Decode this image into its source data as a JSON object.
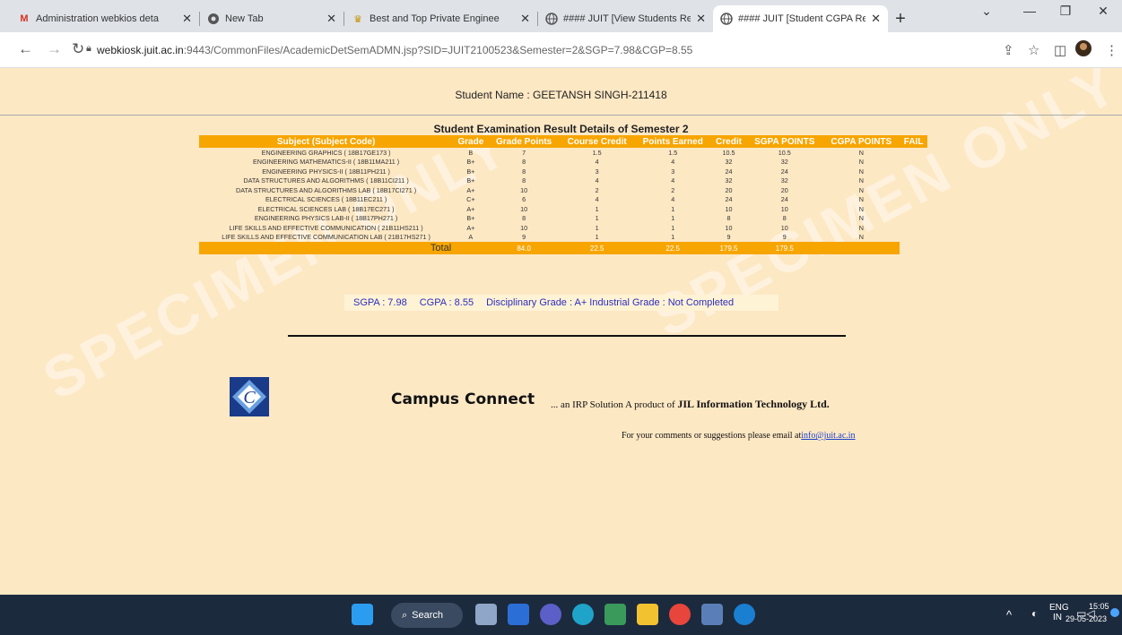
{
  "tabs": [
    {
      "label": "Administration webkios deta",
      "icon": "gmail-icon"
    },
    {
      "label": "New Tab",
      "icon": "chrome-icon"
    },
    {
      "label": "Best and Top Private Enginee",
      "icon": "college-icon"
    },
    {
      "label": "#### JUIT [View Students Re",
      "icon": "globe-icon"
    },
    {
      "label": "#### JUIT [Student CGPA Re",
      "icon": "globe-icon"
    }
  ],
  "address": {
    "host": "webkiosk.juit.ac.in",
    "rest": ":9443/CommonFiles/AcademicDetSemADMN.jsp?SID=JUIT2100523&Semester=2&SGP=7.98&CGP=8.55"
  },
  "page": {
    "student_name": "Student Name : GEETANSH SINGH-211418",
    "section_title": "Student Examination Result Details of Semester 2",
    "watermark": "SPECIMEN ONLY",
    "table": {
      "headers": [
        "Subject (Subject Code)",
        "Grade",
        "Grade Points",
        "Course Credit",
        "Points Earned",
        "Credit",
        "SGPA POINTS",
        "CGPA POINTS",
        "FAIL"
      ],
      "rows": [
        [
          "ENGINEERING GRAPHICS ( 18B17GE173 )",
          "B",
          "7",
          "1.5",
          "1.5",
          "10.5",
          "10.5",
          "N"
        ],
        [
          "ENGINEERING MATHEMATICS-II ( 18B11MA211 )",
          "B+",
          "8",
          "4",
          "4",
          "32",
          "32",
          "N"
        ],
        [
          "ENGINEERING PHYSICS-II ( 18B11PH211 )",
          "B+",
          "8",
          "3",
          "3",
          "24",
          "24",
          "N"
        ],
        [
          "DATA STRUCTURES AND ALGORITHMS ( 18B11CI211 )",
          "B+",
          "8",
          "4",
          "4",
          "32",
          "32",
          "N"
        ],
        [
          "DATA STRUCTURES AND ALGORITHMS LAB ( 18B17CI271 )",
          "A+",
          "10",
          "2",
          "2",
          "20",
          "20",
          "N"
        ],
        [
          "ELECTRICAL SCIENCES ( 18B11EC211 )",
          "C+",
          "6",
          "4",
          "4",
          "24",
          "24",
          "N"
        ],
        [
          "ELECTRICAL SCIENCES LAB ( 18B17EC271 )",
          "A+",
          "10",
          "1",
          "1",
          "10",
          "10",
          "N"
        ],
        [
          "ENGINEERING PHYSICS LAB-II ( 18B17PH271 )",
          "B+",
          "8",
          "1",
          "1",
          "8",
          "8",
          "N"
        ],
        [
          "LIFE SKILLS AND EFFECTIVE COMMUNICATION ( 21B11HS211 )",
          "A+",
          "10",
          "1",
          "1",
          "10",
          "10",
          "N"
        ],
        [
          "LIFE SKILLS AND EFFECTIVE COMMUNICATION LAB ( 21B17HS271 )",
          "A",
          "9",
          "1",
          "1",
          "9",
          "9",
          "N"
        ]
      ],
      "total": {
        "label": "Total",
        "grade_points": "84.0",
        "course_credit": "22.5",
        "earned_credit": "22.5",
        "sgpa_points": "179.5",
        "cgpa_points": "179.5"
      }
    },
    "summary": {
      "sgpa": "SGPA : 7.98",
      "cgpa": "CGPA : 8.55",
      "grades": "Disciplinary Grade : A+ Industrial Grade : Not Completed"
    },
    "footer": {
      "brand": "Campus Connect",
      "tagline_prefix": "... an IRP Solution A product of",
      "tagline_company": "JIL Information Technology Ltd.",
      "contact": "For your comments or suggestions please email at",
      "email": "info@juit.ac.in"
    }
  },
  "taskbar": {
    "search_label": "Search",
    "lang": "ENG",
    "region": "IN",
    "time": "15:05",
    "date": "29-05-2023"
  }
}
